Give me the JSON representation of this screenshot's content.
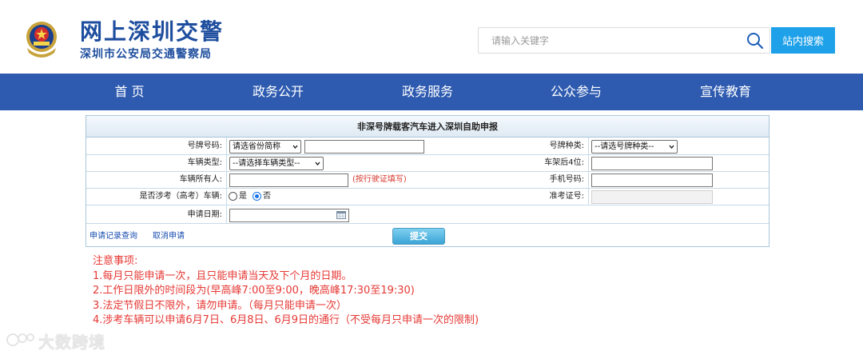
{
  "header": {
    "site_title": "网上深圳交警",
    "site_subtitle": "深圳市公安局交通警察局",
    "search_placeholder": "请输入关键字",
    "search_button": "站内搜索"
  },
  "nav": {
    "items": [
      "首  页",
      "政务公开",
      "政务服务",
      "公众参与",
      "宣传教育"
    ]
  },
  "form": {
    "title": "非深号牌载客汽车进入深圳自助申报",
    "plate_number_label": "号牌号码:",
    "plate_province_select": "请选省份简称",
    "plate_type_label": "号牌种类:",
    "plate_type_select": "--请选号牌种类--",
    "vehicle_type_label": "车辆类型:",
    "vehicle_type_select": "--请选择车辆类型--",
    "frame_last4_label": "车架后4位:",
    "owner_label": "车辆所有人:",
    "owner_hint": "(按行驶证填写)",
    "phone_label": "手机号码:",
    "exam_vehicle_label": "是否涉考（高考）车辆:",
    "radio_yes": "是",
    "radio_no": "否",
    "exam_ticket_label": "准考证号:",
    "apply_date_label": "申请日期:",
    "record_query_link": "申请记录查询",
    "cancel_link": "取消申请",
    "submit_button": "提交"
  },
  "notes": {
    "title": "注意事项:",
    "items": [
      "1.每月只能申请一次，且只能申请当天及下个月的日期。",
      "2.工作日限外的时间段为(早高峰7:00至9:00，晚高峰17:30至19:30)",
      "3.法定节假日不限外，请勿申请。（每月只能申请一次）",
      "4.涉考车辆可以申请6月7日、6月8日、6月9日的通行（不受每月只申请一次的限制)"
    ]
  },
  "watermark": "大数跨境",
  "colors": {
    "brand_blue": "#1d4d9e",
    "nav_bg": "#2e5bb0",
    "search_button_bg": "#1ea1e9",
    "notes_red": "#e53935"
  }
}
